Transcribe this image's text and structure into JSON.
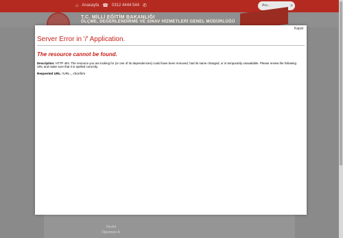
{
  "topbar": {
    "home_label": "Anasayfa",
    "phone": "0312 4444 544",
    "search_placeholder": "Ara..."
  },
  "header": {
    "ministry_line1": "T.C. MİLLİ EĞİTİM BAKANLIĞI",
    "ministry_line2": "ÖLÇME, DEĞERLENDİRME VE SINAV HİZMETLERİ GENEL MÜDÜRLÜĞÜ"
  },
  "background_text": {
    "item1": "Devlet",
    "item2": "Öğretmen A"
  },
  "modal": {
    "close_label": "Kapat",
    "title": "Server Error in '/' Application.",
    "subtitle": "The resource cannot be found.",
    "description_label": "Description:",
    "description_text": "HTTP 404. The resource you are looking for (or one of its dependencies) could have been removed, had its name changed, or is temporarily unavailable.  Please review the following URL and make sure that it is spelled correctly.",
    "requested_url_label": "Requested URL:",
    "requested_url": "/URL-_-/Sonfirm"
  },
  "colors": {
    "accent_red": "#b52a20",
    "error_red": "#c8201a",
    "overlay_gray": "#8a8a8a"
  }
}
